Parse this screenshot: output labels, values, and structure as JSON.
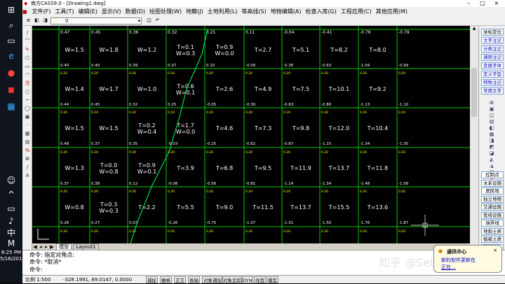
{
  "window": {
    "title": "南方CASS9.0 - [Drawing1.dwg]"
  },
  "menu": [
    "文件(F)",
    "工具(T)",
    "编辑(E)",
    "显示(V)",
    "数据(D)",
    "绘图处理(W)",
    "地籍(J)",
    "土地利用(L)",
    "等高线(S)",
    "地物编辑(A)",
    "检查入库(G)",
    "工程应用(C)",
    "其他应用(M)"
  ],
  "toolbar": {
    "layer_value": "0"
  },
  "grid": {
    "rows": [
      {
        "top": [
          "0.47",
          "0.45",
          "0.36",
          "0.32",
          "0.21",
          "0.11",
          "-0.04",
          "-0.41",
          "-0.76",
          "-0.79"
        ],
        "cells": [
          "W=1.5",
          "W=1.8",
          "W=1.2",
          "T=0.1|W=0.3",
          "T=0.9|W=0.0",
          "T=2.7",
          "T=5.1",
          "T=8.2",
          "T=8.0"
        ],
        "bottom": [
          "0.40",
          "0.40",
          "0.39",
          "0.37",
          "0.10",
          "-0.09",
          "-0.36",
          "-0.63",
          "-1.04",
          "-0.99"
        ]
      },
      {
        "top": [
          "0.20",
          "0.20",
          "0.20",
          "0.20",
          "0.20",
          "0.20",
          "0.20",
          "0.20",
          "0.20",
          "0.20"
        ],
        "cells": [
          "W=1.4",
          "W=1.7",
          "W=1.0",
          "T=0.6|W=0.1",
          "T=2.6",
          "T=4.9",
          "T=7.5",
          "T=10.1",
          "T=9.2"
        ],
        "bottom": [
          "0.44",
          "0.45",
          "0.32",
          "0.25",
          "-0.05",
          "-0.30",
          "-0.63",
          "-0.80",
          "-1.13",
          "-1.10"
        ]
      },
      {
        "top": [
          "0.20",
          "0.20",
          "0.20",
          "0.20",
          "0.20",
          "0.20",
          "0.20",
          "0.20",
          "0.20",
          "0.20"
        ],
        "cells": [
          "W=1.5",
          "W=1.5",
          "T=0.2|W=0.4",
          "T=1.7|W=0.0",
          "T=4.6",
          "T=7.3",
          "T=9.8",
          "T=12.0",
          "T=10.4"
        ],
        "bottom": [
          "0.48",
          "0.37",
          "0.35",
          "-0.03",
          "-0.25",
          "-0.62",
          "-0.87",
          "-1.15",
          "-1.34",
          "-1.35"
        ]
      },
      {
        "top": [
          "0.20",
          "0.20",
          "0.20",
          "0.20",
          "0.20",
          "0.20",
          "0.20",
          "0.20",
          "0.20",
          "0.20"
        ],
        "cells": [
          "W=1.3",
          "T=0.0|W=0.8",
          "T=0.9|W=0.1",
          "T=3.9",
          "T=6.8",
          "T=9.5",
          "T=11.9",
          "T=13.7",
          "T=11.8"
        ],
        "bottom": [
          "0.37",
          "0.38",
          "0.12",
          "-0.08",
          "-0.56",
          "-0.81",
          "-1.14",
          "-1.34",
          "-1.48",
          "-1.58"
        ]
      },
      {
        "top": [
          "0.20",
          "0.20",
          "0.20",
          "0.20",
          "0.20",
          "0.20",
          "0.20",
          "0.20",
          "0.20",
          "0.20"
        ],
        "cells": [
          "W=0.8",
          "T=0.3|W=0.3",
          "T=2.2",
          "T=5.5",
          "T=9.0",
          "T=11.5",
          "T=13.7",
          "T=15.5",
          "T=13.6"
        ],
        "bottom": [
          "0.26",
          "0.27",
          "0.03",
          "-0.26",
          "-0.75",
          "-1.07",
          "-1.31",
          "-1.50",
          "-1.76",
          "-1.87"
        ]
      },
      {
        "top": [
          "0.20",
          "0.20",
          "0.20",
          "0.20",
          "0.20",
          "0.20",
          "0.20",
          "0.20",
          "0.20",
          "0.20"
        ],
        "cells": [
          "T=0.0",
          "T=0.8",
          "",
          "",
          "",
          "",
          "",
          "",
          ""
        ],
        "bottom": []
      }
    ]
  },
  "tabs": {
    "model": "模型",
    "layout": "Layout1"
  },
  "right_panel": {
    "top_buttons": [
      "坐标定位",
      "文字注记",
      "分类注记",
      "通用注记",
      "变换字体",
      "定义字型",
      "特殊注记",
      "常用文字"
    ],
    "bottom_buttons": [
      "控制点",
      "水系设施",
      "居民地",
      "独立地物",
      "交通设施",
      "管线设施",
      "境界线",
      "地貌土质",
      "植被土质",
      "市政部件"
    ]
  },
  "command": {
    "line1_label": "命令:",
    "line1_text": "指定对角点:",
    "line2_label": "命令:",
    "line2_text": "*取消*",
    "line3_label": "命令:"
  },
  "status": {
    "scale": "比例 1:500",
    "coords": "-328.1991, 89.0147, 0.0000",
    "modes": [
      "捕捉",
      "栅格",
      "正交",
      "极轴",
      "对象捕捉",
      "对象追踪",
      "DYN",
      "线宽",
      "模型"
    ]
  },
  "popup": {
    "title": "通讯中心",
    "line1": "新的软件更新在",
    "line2": "正在..."
  },
  "watermark": "知乎 @Seth Hoo",
  "taskbar": {
    "time": "8:25 PM",
    "date": "5/16/2018",
    "ime": "中",
    "ime2": "M"
  }
}
